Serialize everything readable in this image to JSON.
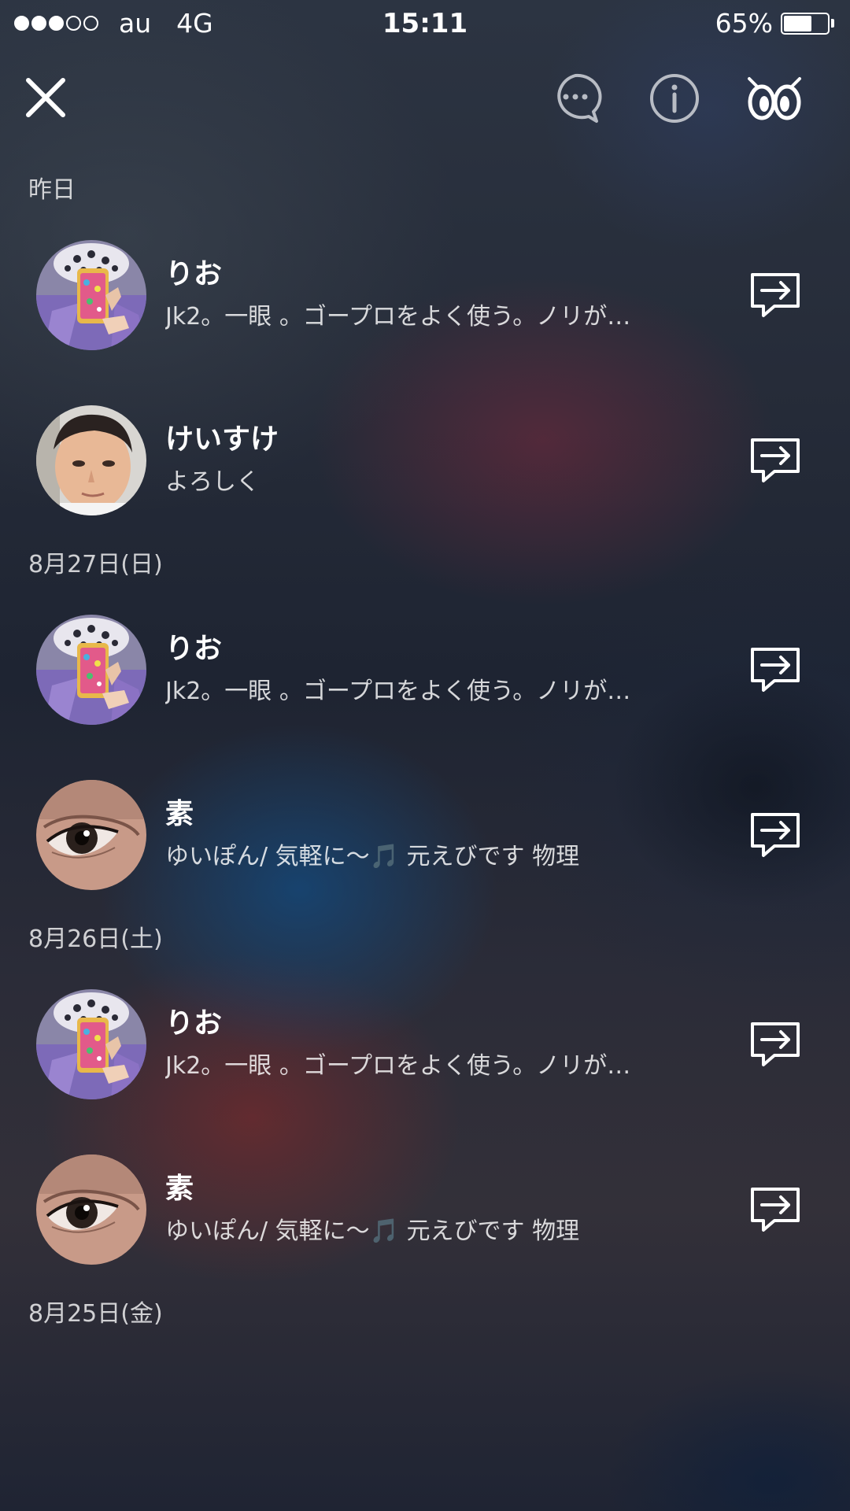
{
  "status_bar": {
    "carrier": "au",
    "network": "4G",
    "time": "15:11",
    "battery_percent_text": "65%",
    "battery_level": 0.65,
    "signal_bars_filled": 3,
    "signal_bars_total": 5
  },
  "header": {
    "icons": [
      "close-icon",
      "chat-bubble-icon",
      "info-icon",
      "eyes-icon"
    ]
  },
  "sections": [
    {
      "date": "昨日",
      "entries": [
        {
          "name": "りお",
          "message": "Jk2。一眼 。ゴープロをよく使う。ノリが…",
          "avatar": "phone-selfie"
        },
        {
          "name": "けいすけ",
          "message": "よろしく",
          "avatar": "boy-face"
        }
      ]
    },
    {
      "date": "8月27日(日)",
      "entries": [
        {
          "name": "りお",
          "message": "Jk2。一眼 。ゴープロをよく使う。ノリが…",
          "avatar": "phone-selfie"
        },
        {
          "name": "素",
          "message": "ゆいぽん/ 気軽に〜🎵 元えびです 物理",
          "avatar": "eye-closeup"
        }
      ]
    },
    {
      "date": "8月26日(土)",
      "entries": [
        {
          "name": "りお",
          "message": "Jk2。一眼 。ゴープロをよく使う。ノリが…",
          "avatar": "phone-selfie"
        },
        {
          "name": "素",
          "message": "ゆいぽん/ 気軽に〜🎵 元えびです 物理",
          "avatar": "eye-closeup"
        }
      ]
    },
    {
      "date": "8月25日(金)",
      "entries": []
    }
  ],
  "colors": {
    "text_primary": "#ffffff",
    "date_header": "#c9cbd0",
    "icon_dim": "#b8bcc4"
  }
}
